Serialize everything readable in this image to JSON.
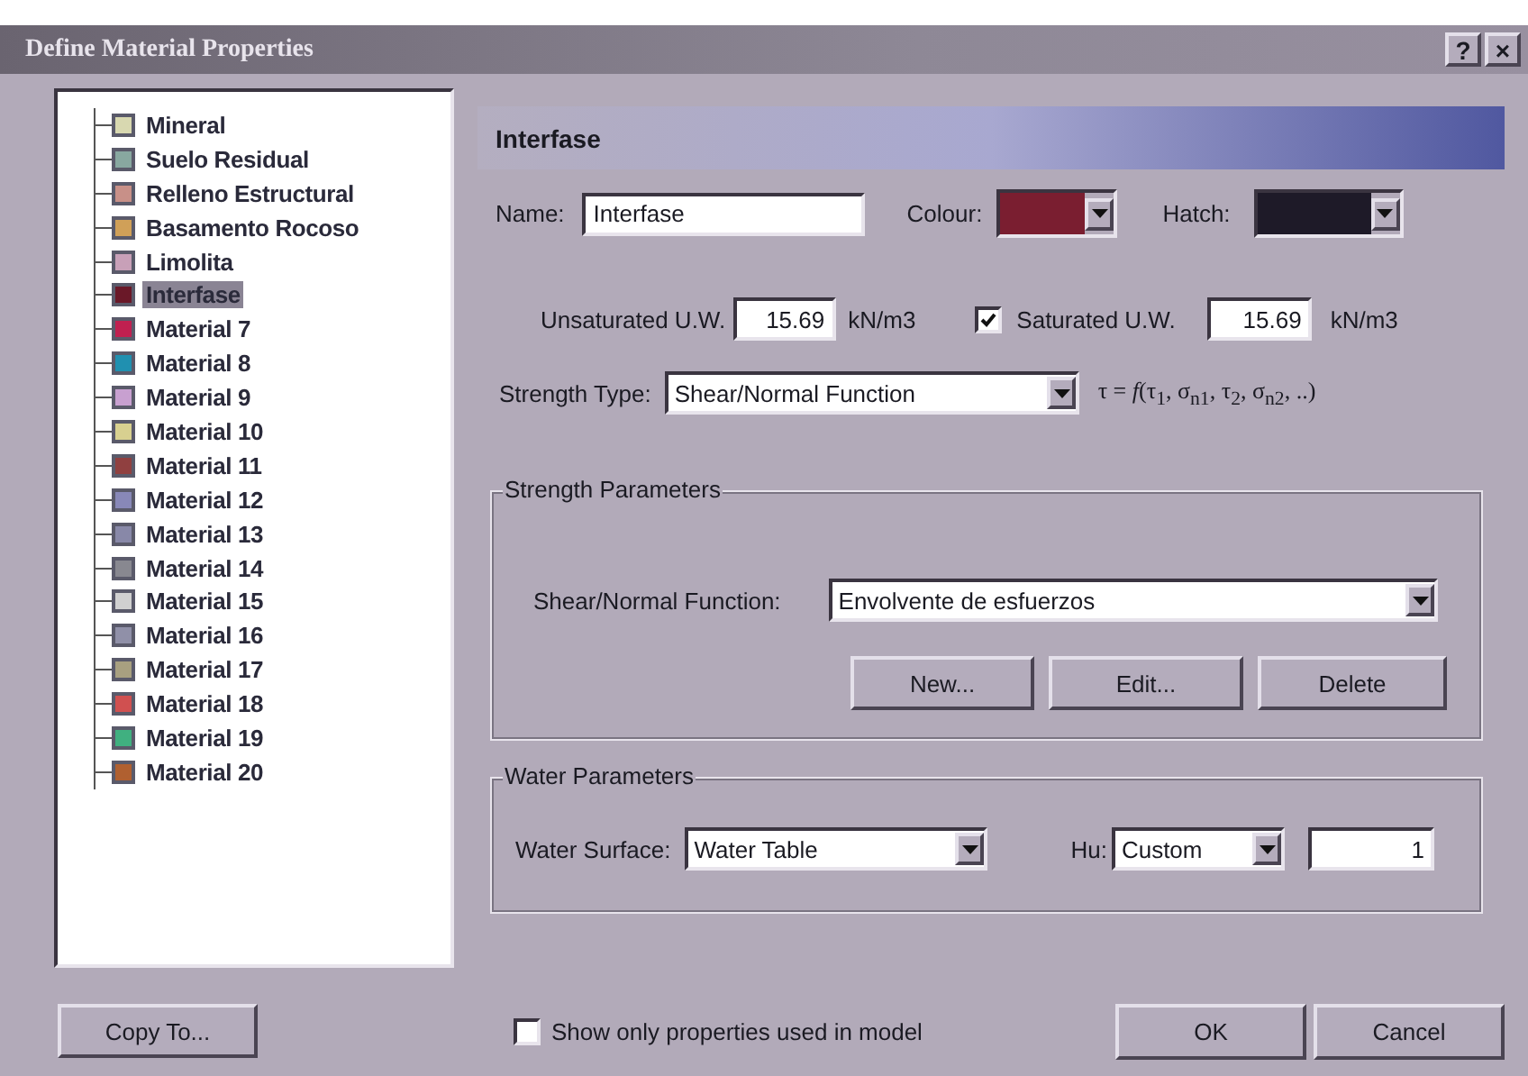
{
  "window": {
    "title": "Define Material Properties",
    "help": "?",
    "close": "×"
  },
  "materials": [
    {
      "name": "Mineral",
      "color": "#d8d8b0",
      "selected": false
    },
    {
      "name": "Suelo Residual",
      "color": "#88a8a0",
      "selected": false
    },
    {
      "name": "Relleno Estructural",
      "color": "#c89088",
      "selected": false
    },
    {
      "name": "Basamento Rocoso",
      "color": "#d0a058",
      "selected": false
    },
    {
      "name": "Limolita",
      "color": "#c8a0b8",
      "selected": false
    },
    {
      "name": "Interfase",
      "color": "#6a1828",
      "selected": true
    },
    {
      "name": "Material 7",
      "color": "#c02050",
      "selected": false
    },
    {
      "name": "Material 8",
      "color": "#2090b0",
      "selected": false
    },
    {
      "name": "Material 9",
      "color": "#c8a0d0",
      "selected": false
    },
    {
      "name": "Material 10",
      "color": "#d8d090",
      "selected": false
    },
    {
      "name": "Material 11",
      "color": "#904040",
      "selected": false
    },
    {
      "name": "Material 12",
      "color": "#8888b8",
      "selected": false
    },
    {
      "name": "Material 13",
      "color": "#8888a8",
      "selected": false
    },
    {
      "name": "Material 14",
      "color": "#888890",
      "selected": false
    },
    {
      "name": "Material 15",
      "color": "#d0d0d0",
      "selected": false
    },
    {
      "name": "Material 16",
      "color": "#9090a8",
      "selected": false
    },
    {
      "name": "Material 17",
      "color": "#a8a080",
      "selected": false
    },
    {
      "name": "Material 18",
      "color": "#d05050",
      "selected": false
    },
    {
      "name": "Material 19",
      "color": "#40b080",
      "selected": false
    },
    {
      "name": "Material 20",
      "color": "#b06030",
      "selected": false
    }
  ],
  "copy_button": "Copy To...",
  "panel_title": "Interfase",
  "name_field": {
    "label": "Name:",
    "value": "Interfase"
  },
  "colour": {
    "label": "Colour:",
    "color": "#7a1e30"
  },
  "hatch": {
    "label": "Hatch:",
    "color": "#1e1a28"
  },
  "unsaturated": {
    "label": "Unsaturated U.W.",
    "value": "15.69",
    "unit": "kN/m3"
  },
  "saturated": {
    "label": "Saturated U.W.",
    "checked": true,
    "value": "15.69",
    "unit": "kN/m3"
  },
  "strength_type": {
    "label": "Strength Type:",
    "value": "Shear/Normal Function",
    "formula": "τ = *f*(τ$_{1}$, σ$_{n1}$, τ$_{2}$, σ$_{n2}$, ..)"
  },
  "strength_parameters": {
    "title": "Strength Parameters",
    "function_label": "Shear/Normal Function:",
    "function_value": "Envolvente de esfuerzos",
    "buttons": [
      "New...",
      "Edit...",
      "Delete"
    ]
  },
  "water_parameters": {
    "title": "Water Parameters",
    "surface_label": "Water Surface:",
    "surface_value": "Water Table",
    "hu_label": "Hu:",
    "hu_value": "Custom",
    "hu_number": "1"
  },
  "show_only": {
    "label": "Show only properties used in model",
    "checked": false
  },
  "buttons": [
    "OK",
    "Cancel"
  ]
}
